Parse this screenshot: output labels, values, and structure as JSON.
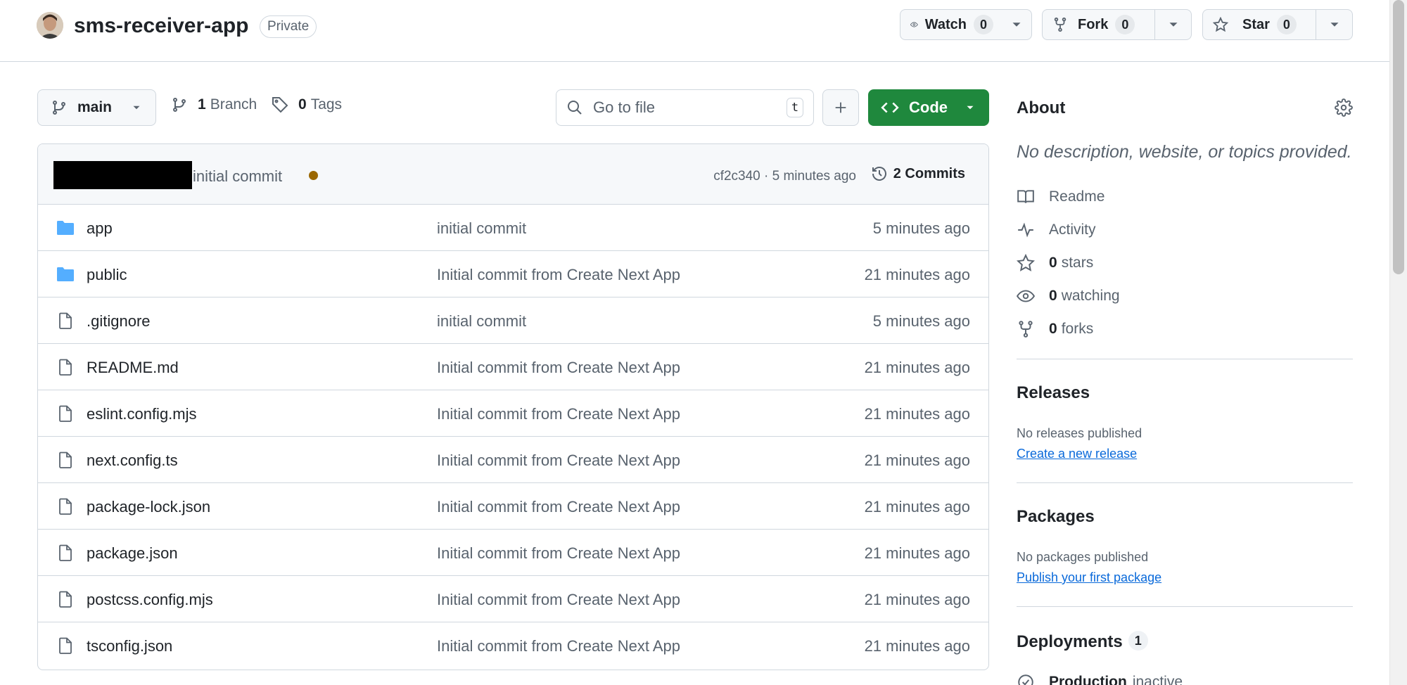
{
  "repo": {
    "name": "sms-receiver-app",
    "visibility": "Private"
  },
  "actions": {
    "watch": {
      "label": "Watch",
      "count": "0"
    },
    "fork": {
      "label": "Fork",
      "count": "0"
    },
    "star": {
      "label": "Star",
      "count": "0"
    }
  },
  "toolbar": {
    "branch": "main",
    "branches_count": "1",
    "branches_label": "Branch",
    "tags_count": "0",
    "tags_label": "Tags",
    "goto_placeholder": "Go to file",
    "goto_shortcut": "t",
    "code_label": "Code"
  },
  "latest_commit": {
    "message": "initial commit",
    "meta": "cf2c340 · 5 minutes ago",
    "commits_label": "2 Commits"
  },
  "files": [
    {
      "type": "folder",
      "name": "app",
      "message": "initial commit",
      "age": "5 minutes ago"
    },
    {
      "type": "folder",
      "name": "public",
      "message": "Initial commit from Create Next App",
      "age": "21 minutes ago"
    },
    {
      "type": "file",
      "name": ".gitignore",
      "message": "initial commit",
      "age": "5 minutes ago"
    },
    {
      "type": "file",
      "name": "README.md",
      "message": "Initial commit from Create Next App",
      "age": "21 minutes ago"
    },
    {
      "type": "file",
      "name": "eslint.config.mjs",
      "message": "Initial commit from Create Next App",
      "age": "21 minutes ago"
    },
    {
      "type": "file",
      "name": "next.config.ts",
      "message": "Initial commit from Create Next App",
      "age": "21 minutes ago"
    },
    {
      "type": "file",
      "name": "package-lock.json",
      "message": "Initial commit from Create Next App",
      "age": "21 minutes ago"
    },
    {
      "type": "file",
      "name": "package.json",
      "message": "Initial commit from Create Next App",
      "age": "21 minutes ago"
    },
    {
      "type": "file",
      "name": "postcss.config.mjs",
      "message": "Initial commit from Create Next App",
      "age": "21 minutes ago"
    },
    {
      "type": "file",
      "name": "tsconfig.json",
      "message": "Initial commit from Create Next App",
      "age": "21 minutes ago"
    }
  ],
  "about": {
    "title": "About",
    "description": "No description, website, or topics provided.",
    "readme": "Readme",
    "activity": "Activity",
    "stars_count": "0",
    "stars_label": "stars",
    "watching_count": "0",
    "watching_label": "watching",
    "forks_count": "0",
    "forks_label": "forks"
  },
  "releases": {
    "title": "Releases",
    "empty": "No releases published",
    "link": "Create a new release"
  },
  "packages": {
    "title": "Packages",
    "empty": "No packages published",
    "link": "Publish your first package"
  },
  "deployments": {
    "title": "Deployments",
    "count": "1",
    "env_name": "Production",
    "env_status": "inactive"
  },
  "colors": {
    "primary_button": "#1f883d",
    "link": "#0969da",
    "folder": "#54aeff",
    "status_dot": "#9a6700"
  }
}
